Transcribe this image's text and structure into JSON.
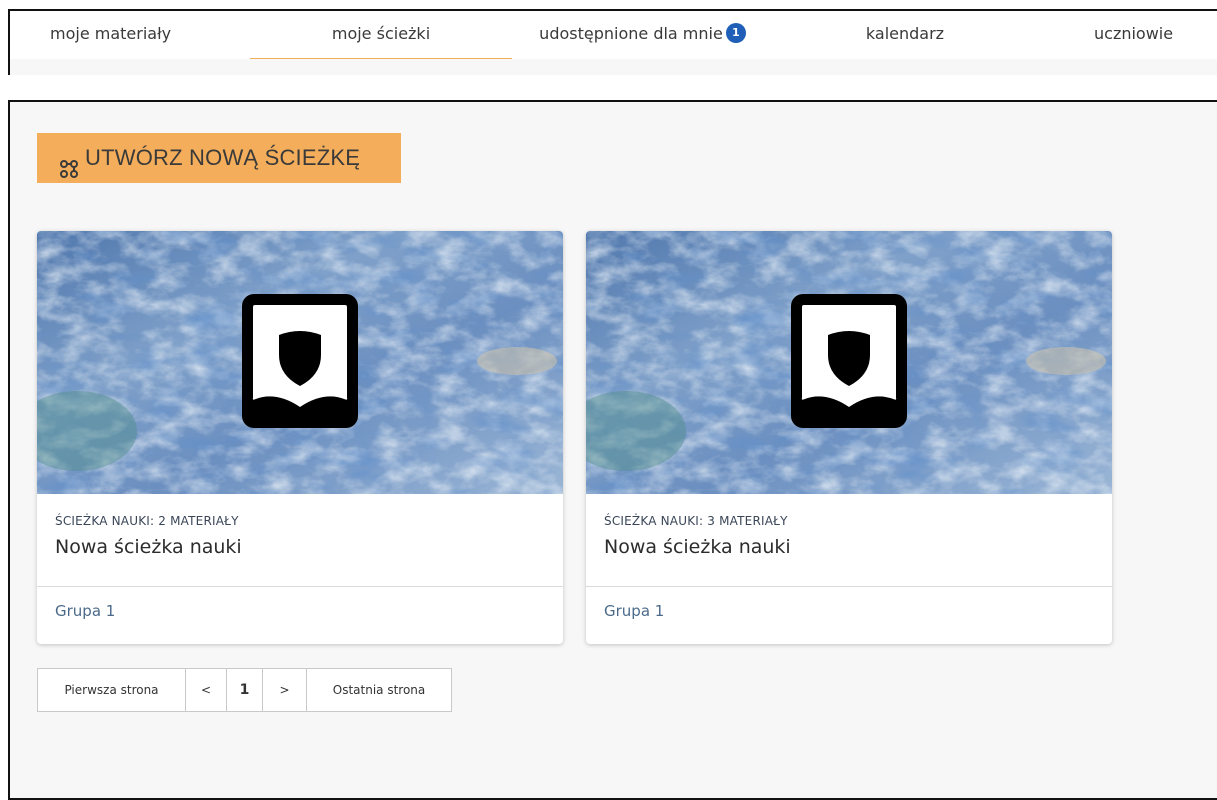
{
  "nav": {
    "tabs": [
      {
        "label": "moje materiały"
      },
      {
        "label": "moje ścieżki",
        "active": true
      },
      {
        "label": "udostępnione dla mnie",
        "badge": "1"
      },
      {
        "label": "kalendarz"
      },
      {
        "label": "uczniowie"
      }
    ]
  },
  "toolbar": {
    "create_label": "UTWÓRZ NOWĄ ŚCIEŻKĘ",
    "create_icon": "path-icon"
  },
  "cards": [
    {
      "meta": "ŚCIEŻKA NAUKI: 2 MATERIAŁY",
      "title": "Nowa ścieżka nauki",
      "group": "Grupa 1",
      "icon": "shield-book-icon"
    },
    {
      "meta": "ŚCIEŻKA NAUKI: 3 MATERIAŁY",
      "title": "Nowa ścieżka nauki",
      "group": "Grupa 1",
      "icon": "shield-book-icon"
    }
  ],
  "pagination": {
    "first": "Pierwsza strona",
    "prev": "<",
    "current": "1",
    "next": ">",
    "last": "Ostatnia strona"
  },
  "colors": {
    "accent": "#f4ae5b",
    "active_tab_underline": "#f0ad5a",
    "badge": "#1f5fb8",
    "panel_bg": "#f7f7f7",
    "link": "#4b6a8a"
  }
}
